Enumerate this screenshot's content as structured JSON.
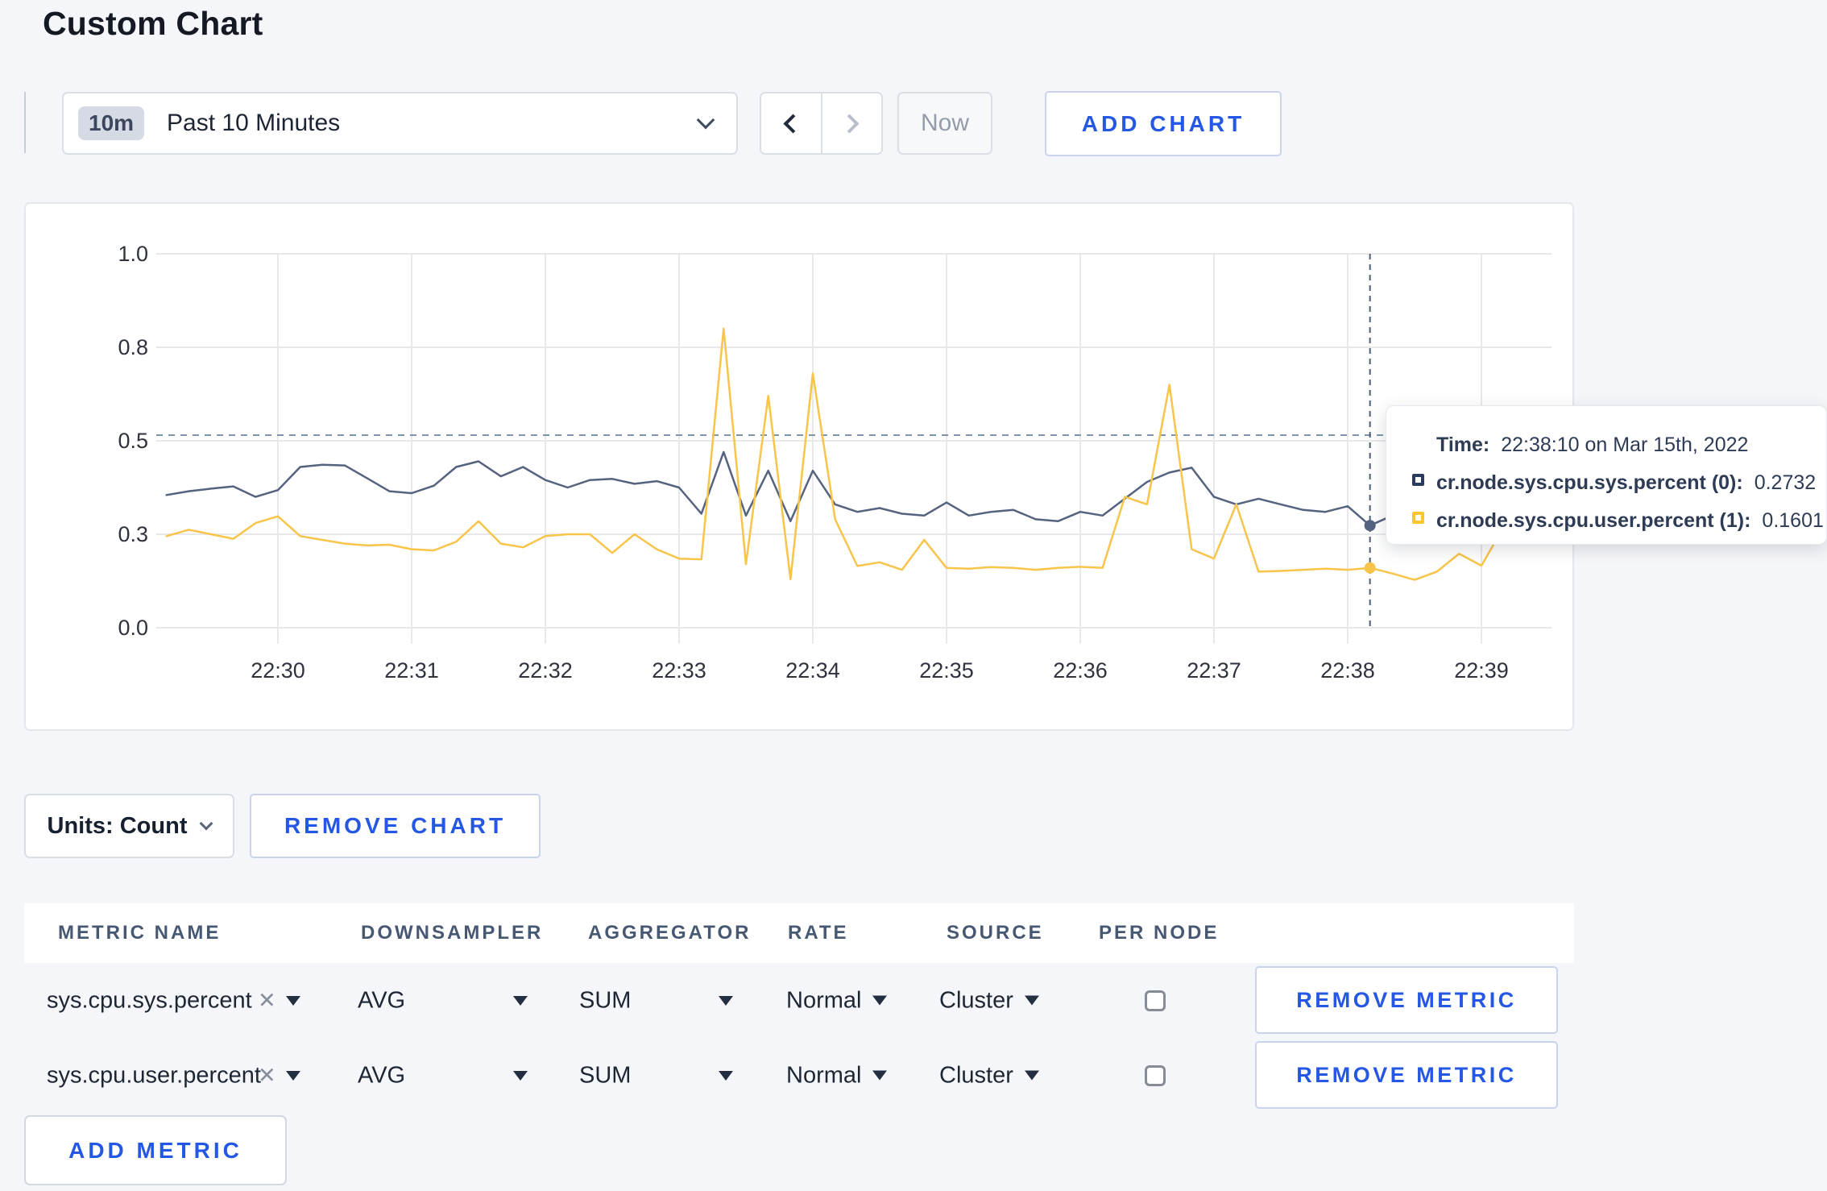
{
  "page": {
    "title": "Custom Chart"
  },
  "toolbar": {
    "time_badge": "10m",
    "time_label": "Past 10 Minutes",
    "now_label": "Now",
    "add_chart_label": "ADD CHART"
  },
  "chart_data": {
    "type": "line",
    "x_ticks": [
      "22:30",
      "22:31",
      "22:32",
      "22:33",
      "22:34",
      "22:35",
      "22:36",
      "22:37",
      "22:38",
      "22:39"
    ],
    "y_ticks": [
      "0.0",
      "0.3",
      "0.5",
      "0.8",
      "1.0"
    ],
    "ylim": [
      0,
      1
    ],
    "grid": true,
    "interval_sec": 10,
    "start_time": "22:29:10",
    "threshold": 0.515,
    "crosshair_index": 54,
    "crosshair_time": "22:38:10",
    "series": [
      {
        "name": "cr.node.sys.cpu.sys.percent (0)",
        "color": "#55637F",
        "values": [
          0.355,
          0.365,
          0.372,
          0.378,
          0.35,
          0.368,
          0.43,
          0.436,
          0.434,
          0.4,
          0.365,
          0.36,
          0.38,
          0.43,
          0.445,
          0.405,
          0.43,
          0.395,
          0.375,
          0.395,
          0.398,
          0.385,
          0.392,
          0.375,
          0.305,
          0.47,
          0.3,
          0.42,
          0.285,
          0.42,
          0.33,
          0.31,
          0.32,
          0.305,
          0.3,
          0.335,
          0.3,
          0.31,
          0.315,
          0.29,
          0.285,
          0.31,
          0.3,
          0.345,
          0.39,
          0.415,
          0.428,
          0.35,
          0.33,
          0.345,
          0.33,
          0.315,
          0.31,
          0.325,
          0.2732,
          0.3,
          0.29,
          0.295,
          0.33,
          0.31,
          0.287,
          0.315
        ]
      },
      {
        "name": "cr.node.sys.cpu.user.percent (1)",
        "color": "#F9C44A",
        "values": [
          0.245,
          0.262,
          0.25,
          0.238,
          0.28,
          0.298,
          0.245,
          0.235,
          0.225,
          0.22,
          0.222,
          0.21,
          0.207,
          0.23,
          0.285,
          0.225,
          0.215,
          0.245,
          0.25,
          0.25,
          0.2,
          0.25,
          0.21,
          0.185,
          0.183,
          0.8,
          0.17,
          0.62,
          0.13,
          0.68,
          0.29,
          0.165,
          0.175,
          0.155,
          0.235,
          0.16,
          0.158,
          0.162,
          0.16,
          0.155,
          0.16,
          0.163,
          0.16,
          0.35,
          0.33,
          0.65,
          0.21,
          0.185,
          0.33,
          0.15,
          0.152,
          0.155,
          0.158,
          0.155,
          0.1601,
          0.145,
          0.128,
          0.15,
          0.198,
          0.166,
          0.27,
          0.245
        ]
      }
    ]
  },
  "tooltip": {
    "time_label": "Time:",
    "time_value": "22:38:10 on Mar 15th, 2022",
    "entries": [
      {
        "name": "cr.node.sys.cpu.sys.percent (0):",
        "value": "0.2732",
        "color": "#2A3B5D"
      },
      {
        "name": "cr.node.sys.cpu.user.percent (1):",
        "value": "0.1601",
        "color": "#FFC531"
      }
    ]
  },
  "chart_controls": {
    "units_label": "Units: Count",
    "remove_chart_label": "REMOVE CHART",
    "add_metric_label": "ADD METRIC"
  },
  "metrics_table": {
    "headers": [
      "METRIC NAME",
      "DOWNSAMPLER",
      "AGGREGATOR",
      "RATE",
      "SOURCE",
      "PER NODE"
    ],
    "rows": [
      {
        "metric": "sys.cpu.sys.percent",
        "downsampler": "AVG",
        "aggregator": "SUM",
        "rate": "Normal",
        "source": "Cluster",
        "per_node": false,
        "remove_label": "REMOVE METRIC"
      },
      {
        "metric": "sys.cpu.user.percent",
        "downsampler": "AVG",
        "aggregator": "SUM",
        "rate": "Normal",
        "source": "Cluster",
        "per_node": false,
        "remove_label": "REMOVE METRIC"
      }
    ]
  }
}
